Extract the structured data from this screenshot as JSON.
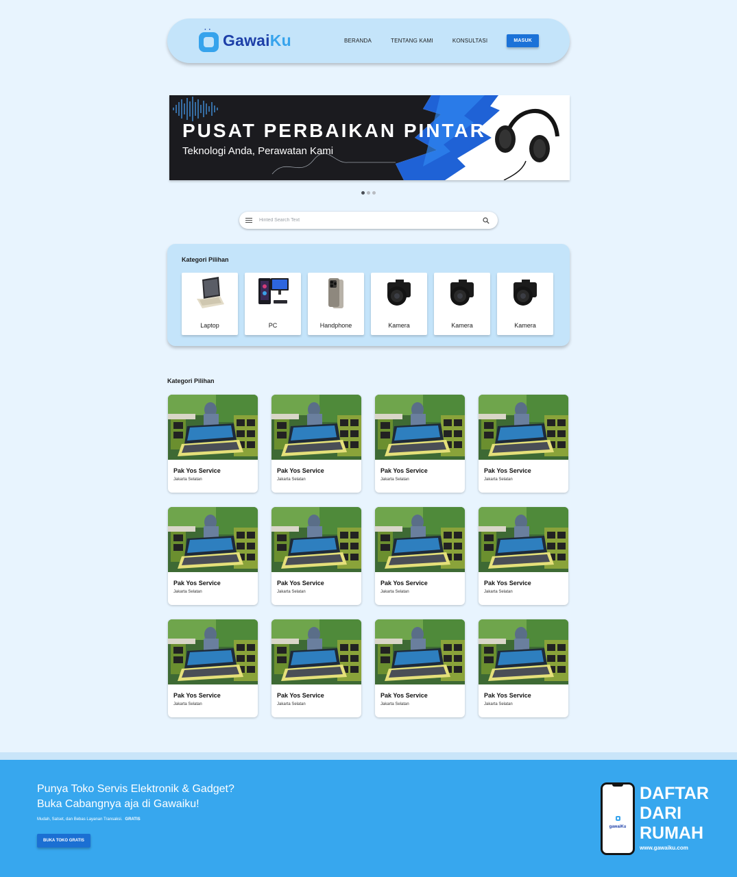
{
  "header": {
    "logo_text_main": "Gawai",
    "logo_text_accent": "Ku",
    "nav": [
      "BERANDA",
      "TENTANG KAMI",
      "KONSULTASI"
    ],
    "login_label": "MASUK"
  },
  "banner": {
    "title": "PUSAT PERBAIKAN PINTAR",
    "subtitle": "Teknologi Anda, Perawatan Kami",
    "slides": 3,
    "active_slide": 1
  },
  "search": {
    "placeholder": "Hinted Search Text",
    "menu_icon": "menu-icon",
    "search_icon": "search-icon"
  },
  "featured_categories": {
    "title": "Kategori Pilihan",
    "items": [
      {
        "label": "Laptop",
        "icon": "laptop-icon"
      },
      {
        "label": "PC",
        "icon": "pc-icon"
      },
      {
        "label": "Handphone",
        "icon": "phone-icon"
      },
      {
        "label": "Kamera",
        "icon": "camera-icon"
      },
      {
        "label": "Kamera",
        "icon": "camera-icon"
      },
      {
        "label": "Kamera",
        "icon": "camera-icon"
      }
    ]
  },
  "services": {
    "title": "Kategori Pilihan",
    "items": [
      {
        "name": "Pak Yos Service",
        "location": "Jakarta Selatan"
      },
      {
        "name": "Pak Yos Service",
        "location": "Jakarta Selatan"
      },
      {
        "name": "Pak Yos Service",
        "location": "Jakarta Selatan"
      },
      {
        "name": "Pak Yos Service",
        "location": "Jakarta Selatan"
      },
      {
        "name": "Pak Yos Service",
        "location": "Jakarta Selatan"
      },
      {
        "name": "Pak Yos Service",
        "location": "Jakarta Selatan"
      },
      {
        "name": "Pak Yos Service",
        "location": "Jakarta Selatan"
      },
      {
        "name": "Pak Yos Service",
        "location": "Jakarta Selatan"
      },
      {
        "name": "Pak Yos Service",
        "location": "Jakarta Selatan"
      },
      {
        "name": "Pak Yos Service",
        "location": "Jakarta Selatan"
      },
      {
        "name": "Pak Yos Service",
        "location": "Jakarta Selatan"
      },
      {
        "name": "Pak Yos Service",
        "location": "Jakarta Selatan"
      }
    ]
  },
  "footer": {
    "line1": "Punya Toko Servis Elektronik & Gadget?",
    "line2": "Buka Cabangnya aja di Gawaiku!",
    "small": "Mudah, Satset, dan Bebas Layanan Transaksi.",
    "small_strong": "GRATIS",
    "cta": "BUKA TOKO GRATIS",
    "phone_logo": "gawaiKu",
    "daftar": [
      "DAFTAR",
      "DARI",
      "RUMAH"
    ],
    "url": "www.gawaiku.com"
  },
  "colors": {
    "page_bg": "#e8f4fe",
    "panel_bg": "#c4e4fa",
    "brand_dark": "#1d3fa8",
    "brand_light": "#36a3ec",
    "button": "#1b72d8",
    "footer_bg": "#37a7ee"
  }
}
